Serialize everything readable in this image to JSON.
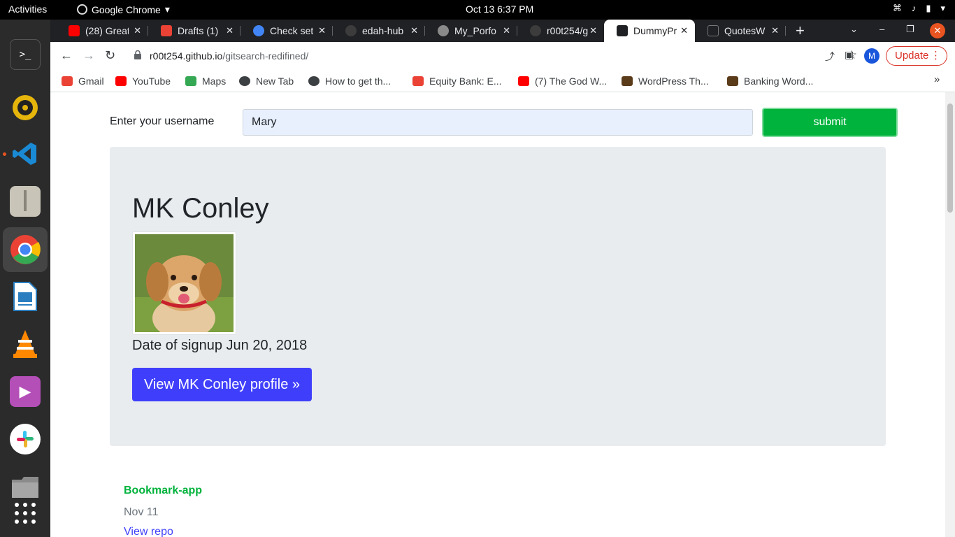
{
  "system": {
    "activities": "Activities",
    "app_name": "Google Chrome",
    "clock": "Oct 13  6:37 PM"
  },
  "dock": [
    {
      "name": "terminal-icon",
      "glyph": ">_",
      "color": "#2c2c2c"
    },
    {
      "name": "rhythmbox-icon",
      "glyph": "",
      "color": "#e5b50c"
    },
    {
      "name": "vscode-icon",
      "glyph": "",
      "color": "#1a8ad4"
    },
    {
      "name": "archive-manager-icon",
      "glyph": "",
      "color": "#c8c4b8"
    },
    {
      "name": "chrome-icon",
      "glyph": "",
      "color": "#34a853"
    },
    {
      "name": "libreoffice-writer-icon",
      "glyph": "",
      "color": "#2a7ec0"
    },
    {
      "name": "vlc-icon",
      "glyph": "",
      "color": "#ff8800"
    },
    {
      "name": "video-player-icon",
      "glyph": "▶",
      "color": "#b44fb8"
    },
    {
      "name": "slack-icon",
      "glyph": "",
      "color": "#ffffff"
    },
    {
      "name": "files-icon",
      "glyph": "",
      "color": "#8b8b8b"
    },
    {
      "name": "show-apps-icon",
      "glyph": "",
      "color": "#2b2b2b"
    }
  ],
  "tabs": [
    {
      "title": "(28) Great",
      "favicon_color": "#ff0000",
      "active": false
    },
    {
      "title": "Drafts (1)",
      "favicon_color": "#ea4335",
      "active": false
    },
    {
      "title": "Check set",
      "favicon_color": "#4285f4",
      "active": false
    },
    {
      "title": "edah-hub",
      "favicon_color": "#3c3c3c",
      "active": false
    },
    {
      "title": "My_Porfo",
      "favicon_color": "#8a8a8a",
      "active": false
    },
    {
      "title": "r00t254/g",
      "favicon_color": "#3c3c3c",
      "active": false
    },
    {
      "title": "DummyPr",
      "favicon_color": "#202124",
      "active": true
    },
    {
      "title": "QuotesW",
      "favicon_color": "#202124",
      "active": false
    }
  ],
  "address": {
    "host": "r00t254.github.io",
    "path": "/gitsearch-redifined/",
    "profile_initial": "M",
    "update_label": "Update"
  },
  "bookmarks": [
    {
      "label": "Gmail",
      "icon_color": "#ea4335"
    },
    {
      "label": "YouTube",
      "icon_color": "#ff0000"
    },
    {
      "label": "Maps",
      "icon_color": "#34a853"
    },
    {
      "label": "New Tab",
      "icon_color": "#3c4043"
    },
    {
      "label": "How to get th...",
      "icon_color": "#3c4043"
    },
    {
      "label": "Equity Bank: E...",
      "icon_color": "#ea4335"
    },
    {
      "label": "(7) The God W...",
      "icon_color": "#ff0000"
    },
    {
      "label": "WordPress Th...",
      "icon_color": "#5a3b1a"
    },
    {
      "label": "Banking Word...",
      "icon_color": "#5a3b1a"
    }
  ],
  "page": {
    "form_label": "Enter your username",
    "username_value": "Mary",
    "submit_label": "submit",
    "user": {
      "name": "MK Conley",
      "signup_text": "Date of signup Jun 20, 2018",
      "profile_button": "View MK Conley profile »"
    },
    "repos": [
      {
        "name": "Bookmark-app",
        "date": "Nov 11",
        "link": "View repo"
      }
    ]
  }
}
